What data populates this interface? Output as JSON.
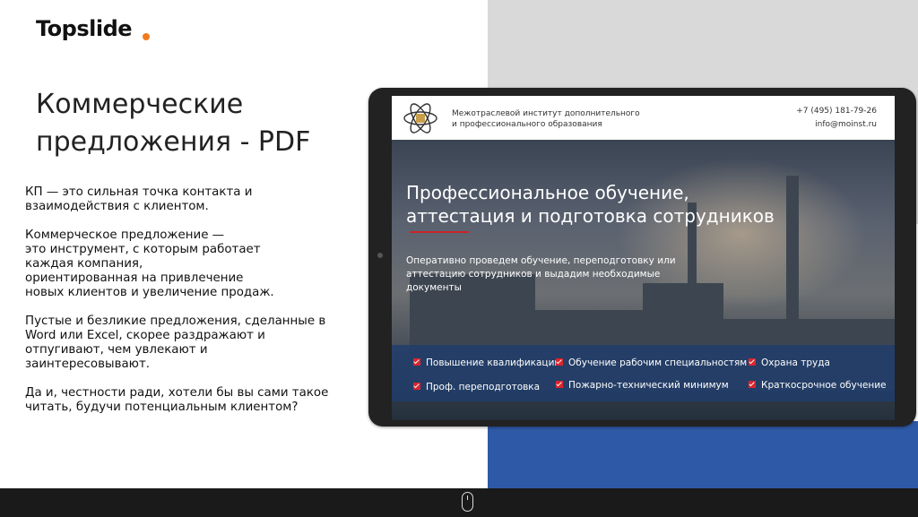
{
  "brand": {
    "name": "Topslide",
    "dot_color": "#f07a1c"
  },
  "slide": {
    "title": "Коммерческие\nпредложения - PDF",
    "paragraphs": [
      "КП — это сильная точка контакта и\nвзаимодействия с клиентом.",
      "Коммерческое предложение —\nэто инструмент, с которым работает\nкаждая компания,\nориентированная на привлечение\nновых клиентов и увеличение продаж.",
      "Пустые и безликие предложения, сделанные в\nWord или Excel, скорее раздражают и\nотпугивают, чем увлекают и\nзаинтересовывают.",
      "Да и, честности ради, хотели бы вы сами такое\nчитать, будучи потенциальным клиентом?"
    ]
  },
  "site": {
    "org_name": "Межотраслевой институт дополнительного\nи профессионального образования",
    "phone": "+7 (495) 181-79-26",
    "email": "info@moinst.ru",
    "hero_title": "Профессиональное обучение,\nаттестация и подготовка сотрудников",
    "hero_subtitle": "Оперативно проведем обучение, переподготовку или\nаттестацию сотрудников и выдадим необходимые\nдокументы",
    "features": [
      "Повышение квалификации",
      "Обучение рабочим специальностям",
      "Охрана труда",
      "Проф. переподготовка",
      "Пожарно-технический минимум",
      "Краткосрочное обучение"
    ]
  },
  "colors": {
    "accent_red": "#d9262e",
    "blue_panel": "#2e59a7",
    "gray_panel": "#d9d9d9"
  }
}
